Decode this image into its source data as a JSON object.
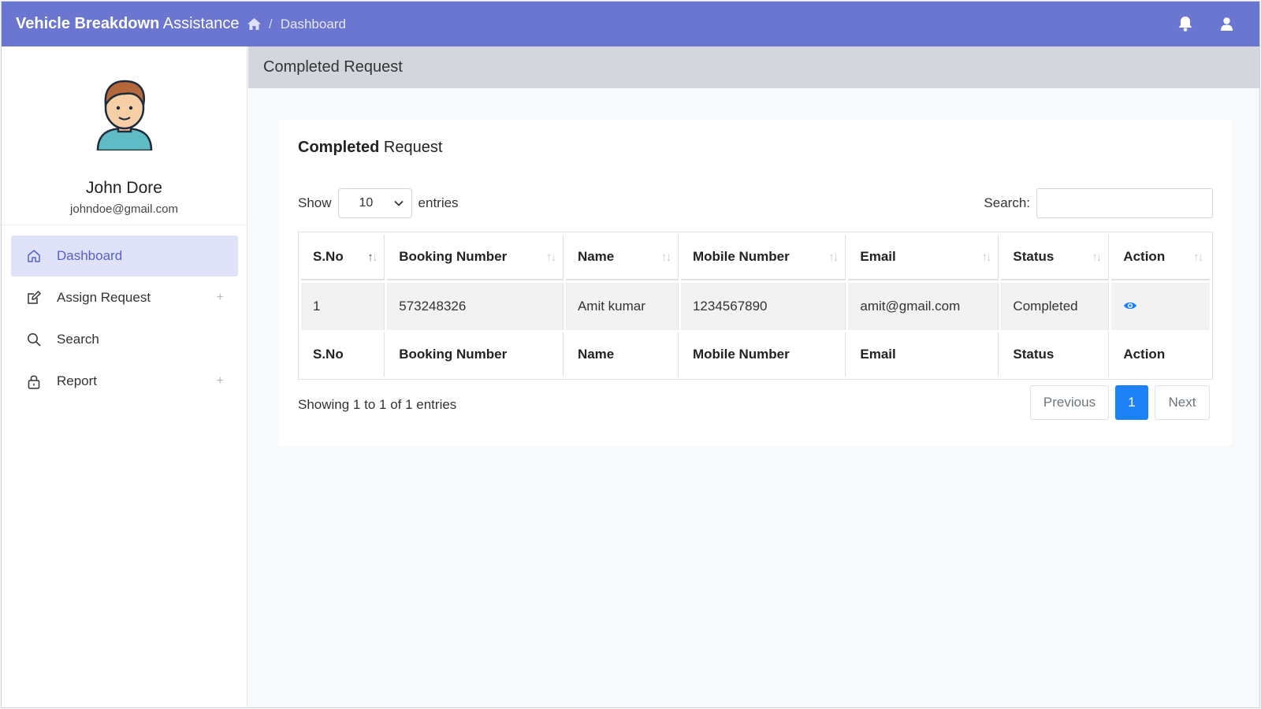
{
  "topbar": {
    "brand_bold": "Vehicle Breakdown",
    "brand_rest": " Assistance",
    "breadcrumb_sep": "/",
    "breadcrumb_current": "Dashboard",
    "bg_color": "#6a76cf",
    "icons": [
      "home-icon",
      "bell-icon",
      "user-icon"
    ]
  },
  "sidebar": {
    "user_name": "John Dore",
    "user_email": "johndoe@gmail.com",
    "items": [
      {
        "label": "Dashboard",
        "icon": "home-outline-icon",
        "active": true,
        "expandable": false
      },
      {
        "label": "Assign Request",
        "icon": "edit-icon",
        "active": false,
        "expandable": true
      },
      {
        "label": "Search",
        "icon": "search-icon",
        "active": false,
        "expandable": false
      },
      {
        "label": "Report",
        "icon": "lock-icon",
        "active": false,
        "expandable": true
      }
    ]
  },
  "content": {
    "header_title": "Completed Request",
    "card_title_bold": "Completed",
    "card_title_rest": " Request",
    "show_label": "Show",
    "entries_value": "10",
    "entries_label": "entries",
    "search_label": "Search:",
    "search_value": "",
    "table": {
      "columns": [
        "S.No",
        "Booking Number",
        "Name",
        "Mobile Number",
        "Email",
        "Status",
        "Action"
      ],
      "rows": [
        {
          "sno": "1",
          "booking": "573248326",
          "name": "Amit kumar",
          "mobile": "1234567890",
          "email": "amit@gmail.com",
          "status": "Completed",
          "action": "view-icon"
        }
      ]
    },
    "info": "Showing 1 to 1 of 1 entries",
    "pager": {
      "previous": "Previous",
      "page": "1",
      "next": "Next"
    },
    "accent_color": "#1d82f5"
  }
}
